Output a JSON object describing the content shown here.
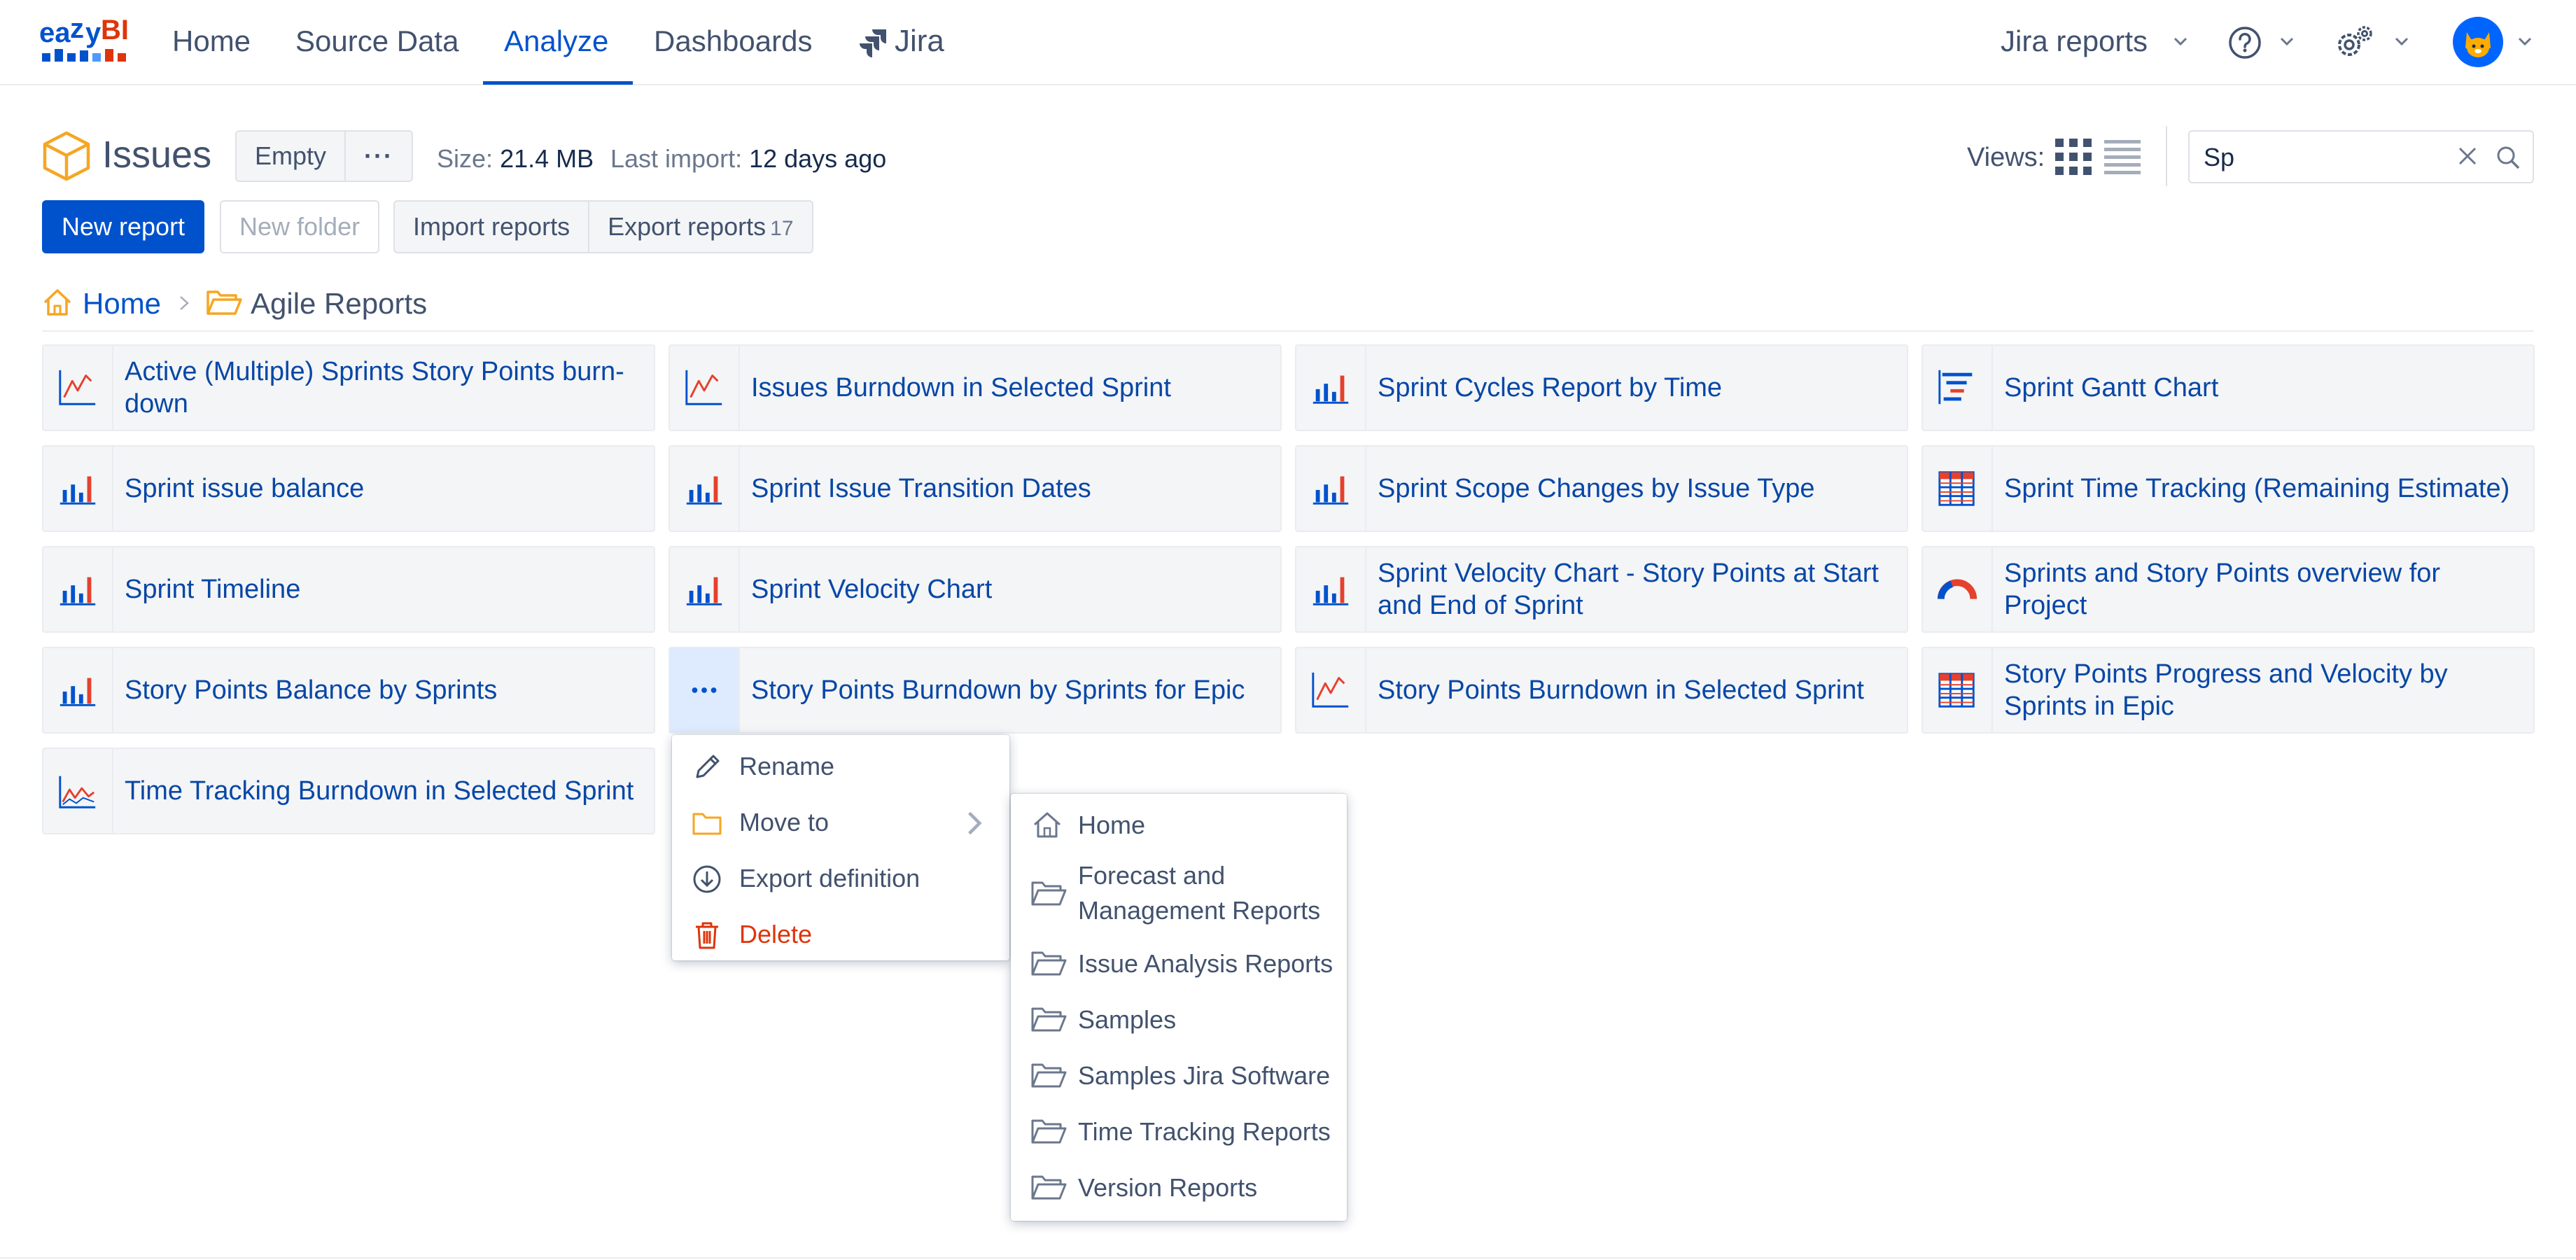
{
  "app": {
    "logo_text": "eazyBI"
  },
  "nav": {
    "items": [
      "Home",
      "Source Data",
      "Analyze",
      "Dashboards"
    ],
    "active": "Analyze",
    "jira_label": "Jira"
  },
  "top_right": {
    "account_label": "Jira reports"
  },
  "header": {
    "title": "Issues",
    "empty_button": "Empty",
    "more_button": "···",
    "size_label": "Size:",
    "size_value": "21.4 MB",
    "import_label": "Last import:",
    "import_value": "12 days ago",
    "views_label": "Views:"
  },
  "search": {
    "value": "Sp"
  },
  "actions": {
    "new_report": "New report",
    "new_folder": "New folder",
    "import_reports": "Import reports",
    "export_reports": "Export reports",
    "export_count": "17"
  },
  "breadcrumb": {
    "home": "Home",
    "current": "Agile Reports"
  },
  "reports": [
    {
      "name": "Active (Multiple) Sprints Story Points burn-down",
      "icon": "line-chart-icon"
    },
    {
      "name": "Issues Burndown in Selected Sprint",
      "icon": "line-chart-icon"
    },
    {
      "name": "Sprint Cycles Report by Time",
      "icon": "bar-chart-icon"
    },
    {
      "name": "Sprint Gantt Chart",
      "icon": "gantt-chart-icon"
    },
    {
      "name": "Sprint issue balance",
      "icon": "bar-chart-icon"
    },
    {
      "name": "Sprint Issue Transition Dates",
      "icon": "bar-chart-icon"
    },
    {
      "name": "Sprint Scope Changes by Issue Type",
      "icon": "bar-chart-icon"
    },
    {
      "name": "Sprint Time Tracking (Remaining Estimate)",
      "icon": "table-icon"
    },
    {
      "name": "Sprint Timeline",
      "icon": "bar-chart-icon"
    },
    {
      "name": "Sprint Velocity Chart",
      "icon": "bar-chart-icon"
    },
    {
      "name": "Sprint Velocity Chart - Story Points at Start and End of Sprint",
      "icon": "bar-chart-icon"
    },
    {
      "name": "Sprints and Story Points overview for Project",
      "icon": "gauge-icon"
    },
    {
      "name": "Story Points Balance by Sprints",
      "icon": "bar-chart-icon"
    },
    {
      "name": "Story Points Burndown by Sprints for Epic",
      "icon": "more-icon"
    },
    {
      "name": "Story Points Burndown in Selected Sprint",
      "icon": "line-chart-icon"
    },
    {
      "name": "Story Points Progress and Velocity by Sprints in Epic",
      "icon": "table-icon"
    },
    {
      "name": "Time Tracking Burndown in Selected Sprint",
      "icon": "area-chart-icon"
    }
  ],
  "context_menu": {
    "items": [
      "Rename",
      "Move to",
      "Export definition",
      "Delete"
    ]
  },
  "move_to_menu": {
    "items": [
      "Home",
      "Forecast and Management Reports",
      "Issue Analysis Reports",
      "Samples",
      "Samples Jira Software",
      "Time Tracking Reports",
      "Version Reports"
    ]
  },
  "colors": {
    "primary": "#0052cc",
    "link": "#0747a6",
    "danger": "#de350b",
    "folder": "#f6a623",
    "chart_red": "#e5412d"
  }
}
